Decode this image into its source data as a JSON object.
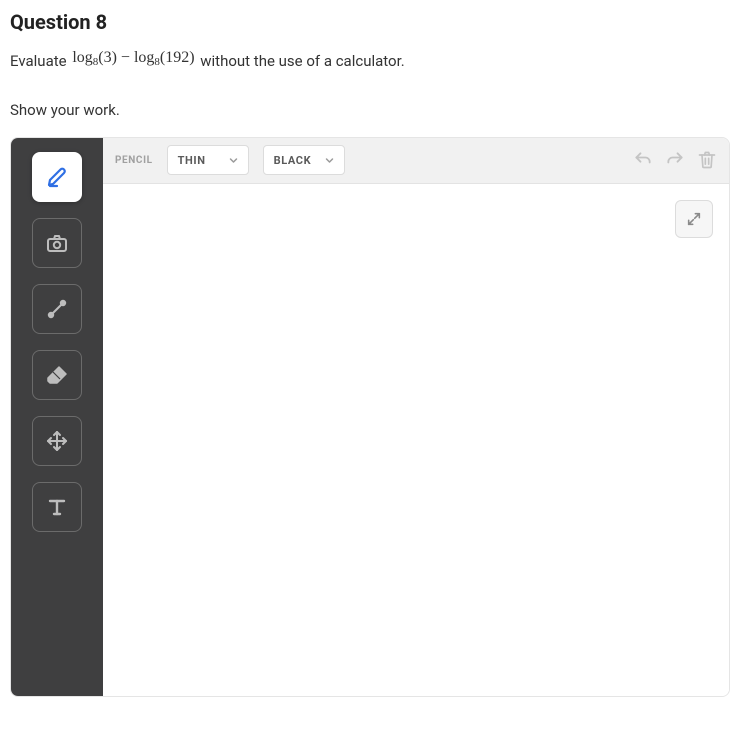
{
  "question": {
    "title": "Question 8",
    "prompt_before": "Evaluate ",
    "math": "log<sub>8</sub>(3) &minus; log<sub>8</sub>(192)",
    "prompt_after": " without the use of a calculator.",
    "instruction": "Show your work."
  },
  "toolbar": {
    "tool_label": "PENCIL",
    "thickness": "THIN",
    "color": "BLACK"
  },
  "tools": {
    "pencil": "pencil-tool",
    "camera": "camera-tool",
    "line": "line-tool",
    "eraser": "eraser-tool",
    "move": "move-tool",
    "text": "text-tool"
  }
}
